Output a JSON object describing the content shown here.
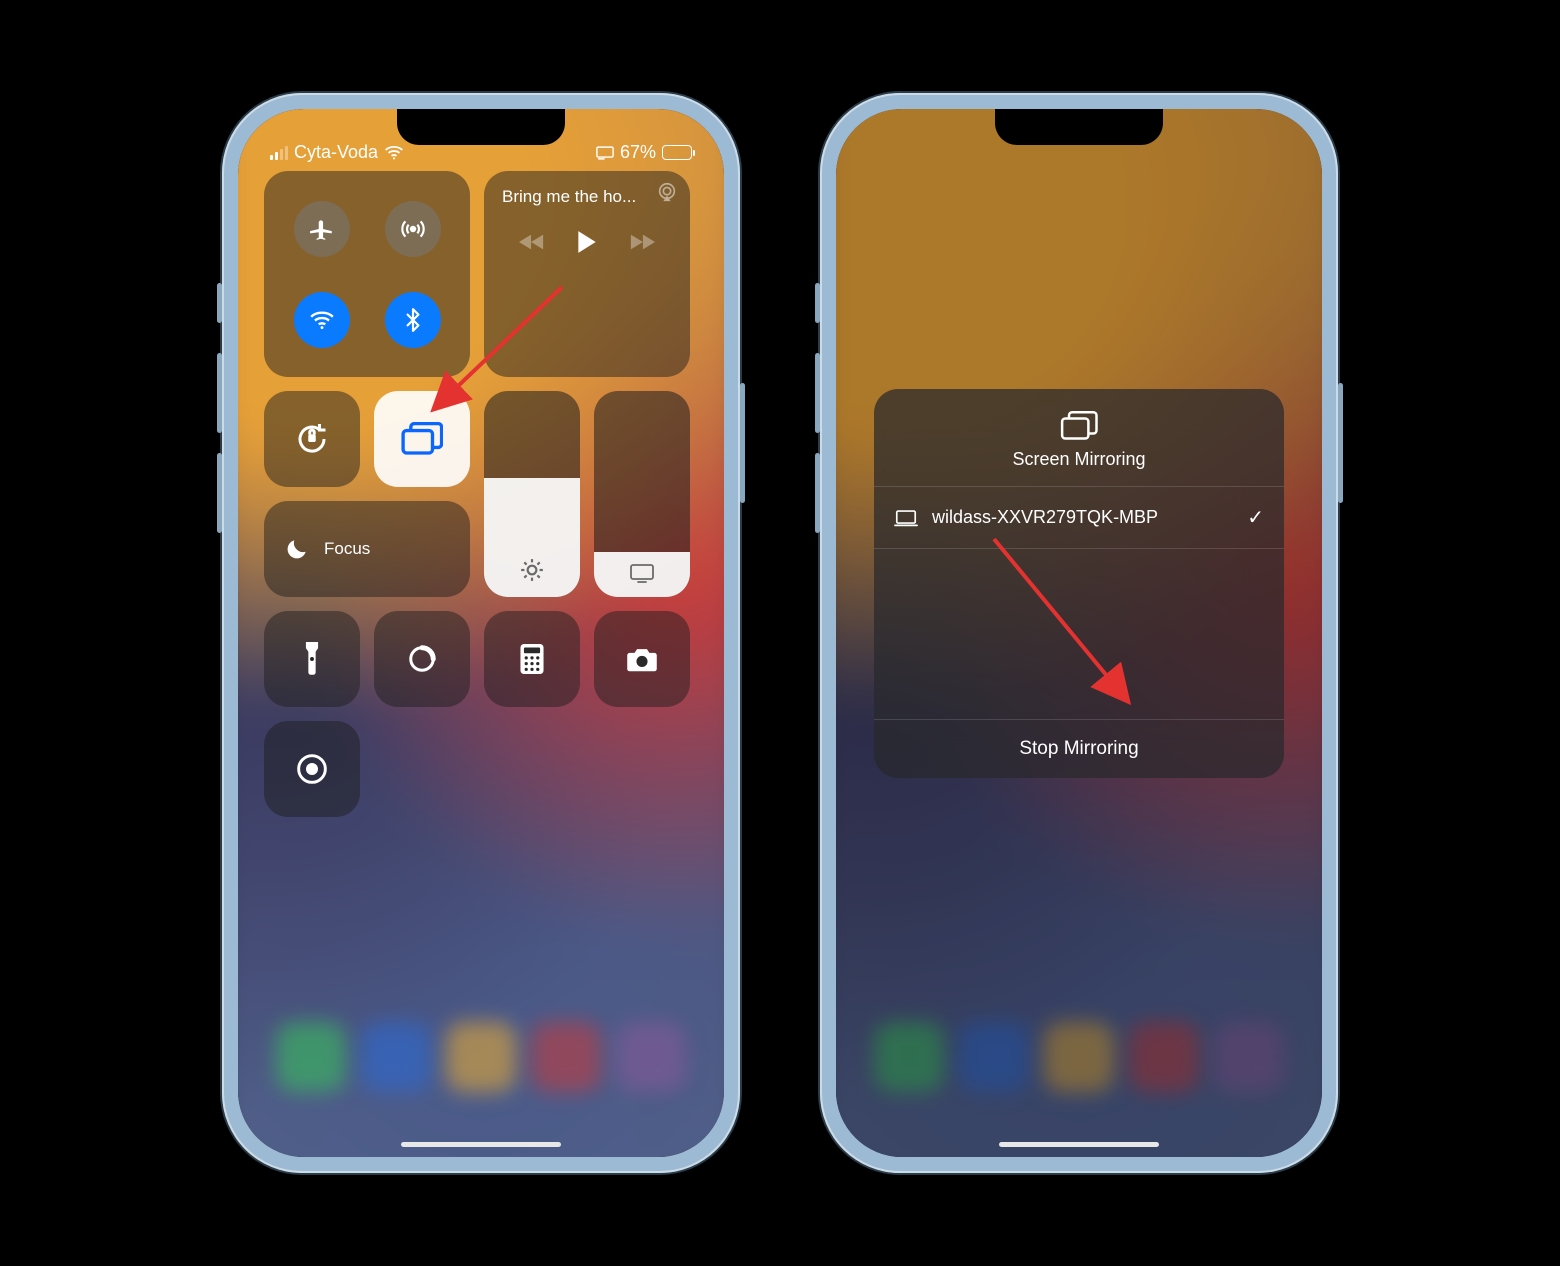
{
  "status": {
    "carrier": "Cyta-Voda",
    "battery_pct": "67%",
    "battery_fill_pct": 67
  },
  "connectivity": {
    "airplane": "airplane-icon",
    "cellular": "antenna-icon",
    "wifi": "wifi-icon",
    "bluetooth": "bluetooth-icon"
  },
  "now_playing": {
    "title": "Bring me the ho..."
  },
  "focus": {
    "label": "Focus"
  },
  "screen_mirroring": {
    "title": "Screen Mirroring",
    "device": "wildass-XXVR279TQK-MBP",
    "stop_label": "Stop Mirroring"
  },
  "dock_colors_left": [
    "#37c759",
    "#2a6bd8",
    "#f0b030",
    "#c93a3a",
    "#8a5a9a"
  ],
  "dock_colors_right": [
    "#37c759",
    "#2a6bd8",
    "#f0b030",
    "#c93a3a",
    "#8a5a9a"
  ]
}
